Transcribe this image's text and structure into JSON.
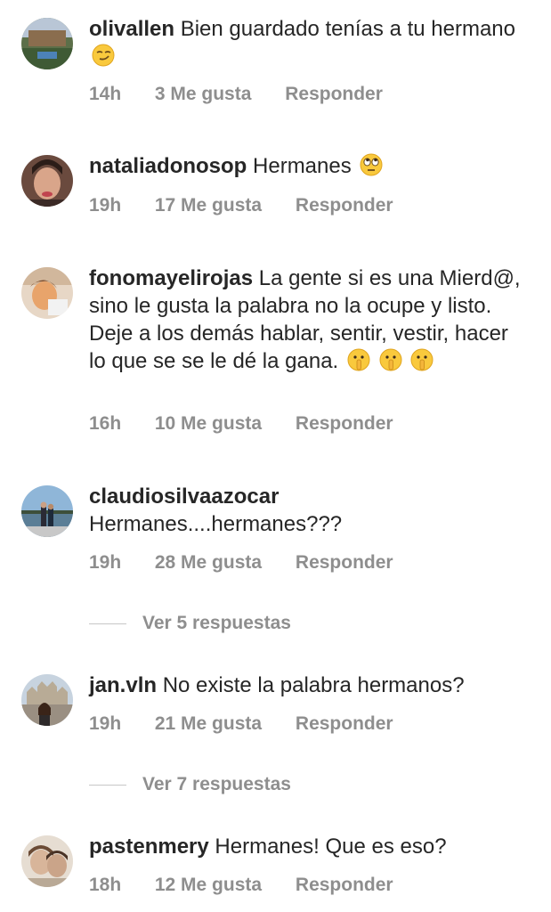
{
  "comments": [
    {
      "username": "olivallen",
      "text": "Bien guardado tenías a tu hermano",
      "emoji": "smirk-emoji",
      "time": "14h",
      "likes": "3 Me gusta",
      "reply": "Responder"
    },
    {
      "username": "nataliadonosop",
      "text": "Hermanes",
      "emoji": "eye-roll-emoji",
      "time": "19h",
      "likes": "17 Me gusta",
      "reply": "Responder"
    },
    {
      "username": "fonomayelirojas",
      "text": "La gente si es una Mierd@, sino le gusta la palabra no la ocupe y listo. Deje a los demás hablar, sentir, vestir, hacer lo que se se le dé la gana.",
      "emoji": "shushing-face-emoji",
      "time": "16h",
      "likes": "10 Me gusta",
      "reply": "Responder"
    },
    {
      "username": "claudiosilvaazocar",
      "text": "Hermanes....hermanes???",
      "time": "19h",
      "likes": "28 Me gusta",
      "reply": "Responder",
      "view_replies": "Ver 5 respuestas"
    },
    {
      "username": "jan.vln",
      "text": "No existe la palabra hermanos?",
      "time": "19h",
      "likes": "21 Me gusta",
      "reply": "Responder",
      "view_replies": "Ver 7 respuestas"
    },
    {
      "username": "pastenmery",
      "text": "Hermanes! Que es eso?",
      "time": "18h",
      "likes": "12 Me gusta",
      "reply": "Responder"
    }
  ]
}
